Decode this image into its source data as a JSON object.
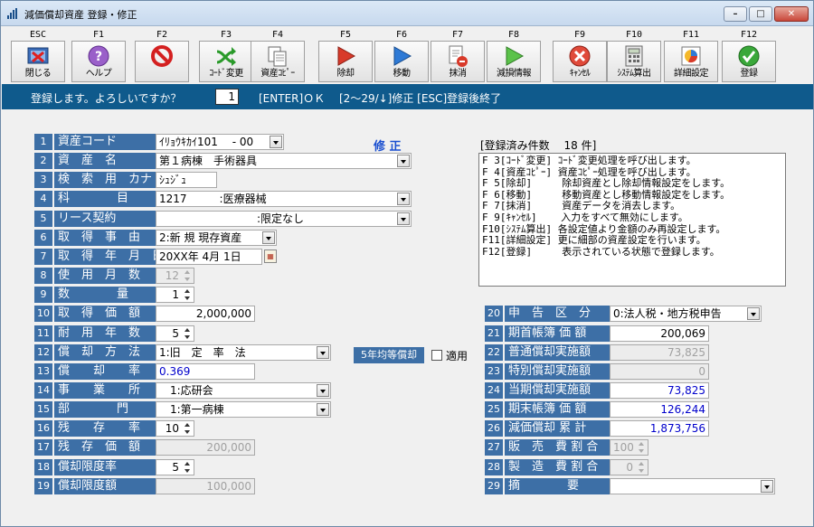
{
  "window": {
    "title": "減価償却資産 登録・修正"
  },
  "toolbar": [
    {
      "key": "ESC",
      "label": "閉じる",
      "icon": "exit-icon"
    },
    {
      "key": "F1",
      "label": "ヘルプ",
      "icon": "help-icon"
    },
    {
      "key": "F2",
      "label": "",
      "icon": "prohibit-icon"
    },
    {
      "key": "F3",
      "label": "ｺｰﾄﾞ変更",
      "icon": "code-change-icon"
    },
    {
      "key": "F4",
      "label": "資産ｺﾋﾟｰ",
      "icon": "copy-icon"
    },
    {
      "key": "F5",
      "label": "除却",
      "icon": "red-arrow-icon"
    },
    {
      "key": "F6",
      "label": "移動",
      "icon": "blue-arrow-icon"
    },
    {
      "key": "F7",
      "label": "抹消",
      "icon": "delete-document-icon"
    },
    {
      "key": "F8",
      "label": "減損情報",
      "icon": "green-arrow-icon"
    },
    {
      "key": "F9",
      "label": "ｷｬﾝｾﾙ",
      "icon": "cancel-icon"
    },
    {
      "key": "F10",
      "label": "ｼｽﾃﾑ算出",
      "icon": "calculator-icon"
    },
    {
      "key": "F11",
      "label": "詳細設定",
      "icon": "detail-settings-icon"
    },
    {
      "key": "F12",
      "label": "登録",
      "icon": "check-icon"
    }
  ],
  "prompt": {
    "message": "登録します。よろしいですか？",
    "input_value": "1",
    "hint_enter": "[ENTER]ＯＫ",
    "hint_fix": "[2～29/↓]修正 [ESC]登録後終了"
  },
  "status": {
    "mode": "修 正",
    "registered": "[登録済み件数　 18 件]"
  },
  "help_lines": [
    "F 3[ｺｰﾄﾞ変更] ｺｰﾄﾞ変更処理を呼び出します。",
    "F 4[資産ｺﾋﾟｰ] 資産ｺﾋﾟｰ処理を呼び出します。",
    "F 5[除却]     除却資産とし除却情報設定をします。",
    "F 6[移動]     移動資産とし移動情報設定をします。",
    "F 7[抹消]     資産データを消去します。",
    "F 9[ｷｬﾝｾﾙ]    入力をすべて無効にします。",
    "F10[ｼｽﾃﾑ算出] 各設定値より金額のみ再設定します。",
    "F11[詳細設定] 更に細部の資産設定を行います。",
    "F12[登録]     表示されている状態で登録します。"
  ],
  "left_fields": [
    {
      "no": "1",
      "label": "資産コード",
      "value": "ｲﾘｮｳｷｶｲ101　 - 00",
      "kind": "dd"
    },
    {
      "no": "2",
      "label": "資　産　名",
      "value": "第１病棟　手術器具",
      "kind": "dd"
    },
    {
      "no": "3",
      "label": "検　索　用　カナ",
      "value": "ｼｭｼﾞｭ",
      "kind": "text"
    },
    {
      "no": "4",
      "label": "科　　　　目",
      "value": "1217　　　:医療器械",
      "kind": "dd"
    },
    {
      "no": "5",
      "label": "リース契約",
      "value": "　　　　　　　　　:限定なし",
      "kind": "dd"
    },
    {
      "no": "6",
      "label": "取　得　事　由",
      "value": "2:新 規 現存資産",
      "kind": "dd"
    },
    {
      "no": "7",
      "label": "取　得　年　月　日",
      "value": "20XX年 4月 1日",
      "kind": "date"
    },
    {
      "no": "8",
      "label": "使　用　月　数",
      "value": "12",
      "kind": "spin-dis"
    },
    {
      "no": "9",
      "label": "数　　　　量",
      "value": "1",
      "kind": "spin"
    },
    {
      "no": "10",
      "label": "取　得　価　額",
      "value": "2,000,000",
      "kind": "num"
    },
    {
      "no": "11",
      "label": "耐　用　年　数",
      "value": "5",
      "kind": "spin"
    },
    {
      "no": "12",
      "label": "償　却　方　法",
      "value": "1:旧　定　率　法",
      "kind": "dd"
    },
    {
      "no": "13",
      "label": "償　　却　　率",
      "value": "0.369",
      "kind": "blue"
    },
    {
      "no": "14",
      "label": "事　　業　　所",
      "value": "　1:応研会",
      "kind": "dd"
    },
    {
      "no": "15",
      "label": "部　　　　門",
      "value": "　1:第一病棟",
      "kind": "dd"
    },
    {
      "no": "16",
      "label": "残　　存　　率",
      "value": "10",
      "kind": "spin"
    },
    {
      "no": "17",
      "label": "残　存　価　額",
      "value": "200,000",
      "kind": "num-dis"
    },
    {
      "no": "18",
      "label": "償却限度率",
      "value": "5",
      "kind": "spin"
    },
    {
      "no": "19",
      "label": "償却限度額",
      "value": "100,000",
      "kind": "num-dis"
    }
  ],
  "equal_button": {
    "label": "5年均等償却",
    "check_label": "適用"
  },
  "right_fields": [
    {
      "no": "20",
      "label": "申　告　区　分",
      "value": "0:法人税・地方税申告",
      "kind": "dd"
    },
    {
      "no": "21",
      "label": "期首帳簿 価 額",
      "value": "200,069",
      "kind": "num"
    },
    {
      "no": "22",
      "label": "普通償却実施額",
      "value": "73,825",
      "kind": "num-dis"
    },
    {
      "no": "23",
      "label": "特別償却実施額",
      "value": "0",
      "kind": "num-dis"
    },
    {
      "no": "24",
      "label": "当期償却実施額",
      "value": "73,825",
      "kind": "num-blue"
    },
    {
      "no": "25",
      "label": "期末帳簿 価 額",
      "value": "126,244",
      "kind": "num-blue"
    },
    {
      "no": "26",
      "label": "減価償却 累 計",
      "value": "1,873,756",
      "kind": "num-blue"
    },
    {
      "no": "27",
      "label": "販　売　費 割 合",
      "value": "100",
      "kind": "spin-dis"
    },
    {
      "no": "28",
      "label": "製　造　費 割 合",
      "value": "0",
      "kind": "spin-dis"
    },
    {
      "no": "29",
      "label": "摘　　　　要",
      "value": "",
      "kind": "dd"
    }
  ]
}
